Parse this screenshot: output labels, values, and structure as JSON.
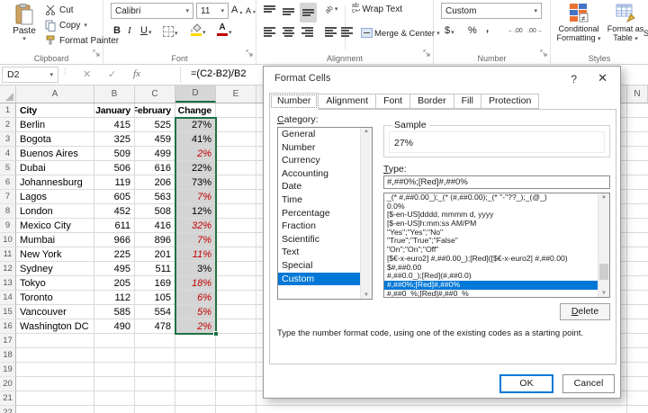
{
  "ribbon": {
    "clipboard": {
      "group_label": "Clipboard",
      "paste_label": "Paste",
      "cut_label": "Cut",
      "copy_label": "Copy",
      "format_painter_label": "Format Painter"
    },
    "font": {
      "group_label": "Font",
      "name_value": "Calibri",
      "size_value": "11",
      "bold": "B",
      "italic": "I",
      "underline": "U"
    },
    "alignment": {
      "group_label": "Alignment",
      "wrap_label": "Wrap Text",
      "merge_label": "Merge & Center"
    },
    "number": {
      "group_label": "Number",
      "format_value": "Custom",
      "currency": "$",
      "percent": "%",
      "comma": ",",
      "increase_decimal": "←.00",
      "decrease_decimal": ".00→"
    },
    "styles": {
      "group_label": "Styles",
      "conditional_label": "Conditional Formatting",
      "format_table_label": "Format as Table",
      "clipped_letter": "S"
    }
  },
  "formula_bar": {
    "name_box": "D2",
    "formula": "=(C2-B2)/B2"
  },
  "icons": {
    "dropdown_caret": "▾",
    "cancel_x": "✕",
    "check_mark": "✓",
    "function_fx": "fx",
    "separator_dots": "⁞",
    "help": "?",
    "close": "✕",
    "scroll_up": "▲",
    "scroll_down": "▼",
    "font_letter": "A",
    "grow_arrow": "▲",
    "shrink_arrow": "▼",
    "orientation_ab": "ab",
    "wrap_line1": "ab",
    "wrap_line2": "c↩"
  },
  "sheet": {
    "column_headers": [
      "A",
      "B",
      "C",
      "D",
      "E"
    ],
    "far_column_header": "N",
    "visible_row_count": 22,
    "header_row": [
      "City",
      "January",
      "February",
      "% Change"
    ],
    "rows": [
      {
        "row": 2,
        "city": "Berlin",
        "january": "415",
        "february": "525",
        "change": "27%",
        "negative": false
      },
      {
        "row": 3,
        "city": "Bogota",
        "january": "325",
        "february": "459",
        "change": "41%",
        "negative": false
      },
      {
        "row": 4,
        "city": "Buenos Aires",
        "january": "509",
        "february": "499",
        "change": "2%",
        "negative": true
      },
      {
        "row": 5,
        "city": "Dubai",
        "january": "506",
        "february": "616",
        "change": "22%",
        "negative": false
      },
      {
        "row": 6,
        "city": "Johannesburg",
        "january": "119",
        "february": "206",
        "change": "73%",
        "negative": false
      },
      {
        "row": 7,
        "city": "Lagos",
        "january": "605",
        "february": "563",
        "change": "7%",
        "negative": true
      },
      {
        "row": 8,
        "city": "London",
        "january": "452",
        "february": "508",
        "change": "12%",
        "negative": false
      },
      {
        "row": 9,
        "city": "Mexico City",
        "january": "611",
        "february": "416",
        "change": "32%",
        "negative": true
      },
      {
        "row": 10,
        "city": "Mumbai",
        "january": "966",
        "february": "896",
        "change": "7%",
        "negative": true
      },
      {
        "row": 11,
        "city": "New York",
        "january": "225",
        "february": "201",
        "change": "11%",
        "negative": true
      },
      {
        "row": 12,
        "city": "Sydney",
        "january": "495",
        "february": "511",
        "change": "3%",
        "negative": false
      },
      {
        "row": 13,
        "city": "Tokyo",
        "january": "205",
        "february": "169",
        "change": "18%",
        "negative": true
      },
      {
        "row": 14,
        "city": "Toronto",
        "january": "112",
        "february": "105",
        "change": "6%",
        "negative": true
      },
      {
        "row": 15,
        "city": "Vancouver",
        "january": "585",
        "february": "554",
        "change": "5%",
        "negative": true
      },
      {
        "row": 16,
        "city": "Washington DC",
        "january": "490",
        "february": "478",
        "change": "2%",
        "negative": true
      }
    ]
  },
  "dialog": {
    "title": "Format Cells",
    "help": "?",
    "close": "✕",
    "tabs": [
      "Number",
      "Alignment",
      "Font",
      "Border",
      "Fill",
      "Protection"
    ],
    "active_tab_index": 0,
    "category_label": "Category:",
    "categories": [
      "General",
      "Number",
      "Currency",
      "Accounting",
      "Date",
      "Time",
      "Percentage",
      "Fraction",
      "Scientific",
      "Text",
      "Special",
      "Custom"
    ],
    "selected_category": "Custom",
    "sample_label": "Sample",
    "sample_value": "27%",
    "type_label": "Type:",
    "type_value": "#,##0%;[Red]#,##0%",
    "type_options": [
      "_(* #,##0.00_);_(* (#,##0.00);_(* \"-\"??_);_(@_)",
      "0.0%",
      "[$-en-US]dddd, mmmm d, yyyy",
      "[$-en-US]h:mm:ss AM/PM",
      "\"Yes\";\"Yes\";\"No\"",
      "\"True\";\"True\";\"False\"",
      "\"On\";\"On\";\"Off\"",
      "[$€-x-euro2] #,##0.00_);[Red]([$€-x-euro2] #,##0.00)",
      "$#,##0.00",
      "#,##0.0_);[Red](#,##0.0)",
      "#,##0%;[Red]#,##0%",
      "#,##0_%;[Red]#,##0_%"
    ],
    "selected_type_index": 10,
    "delete_label": "Delete",
    "description": "Type the number format code, using one of the existing codes as a starting point.",
    "ok_label": "OK",
    "cancel_label": "Cancel"
  },
  "colors": {
    "excel_green": "#1e7145",
    "selection_grey": "#d4d4d4",
    "negative_red": "#c00000",
    "highlight_blue": "#0078d7",
    "fill_yellow": "#ffd800"
  }
}
